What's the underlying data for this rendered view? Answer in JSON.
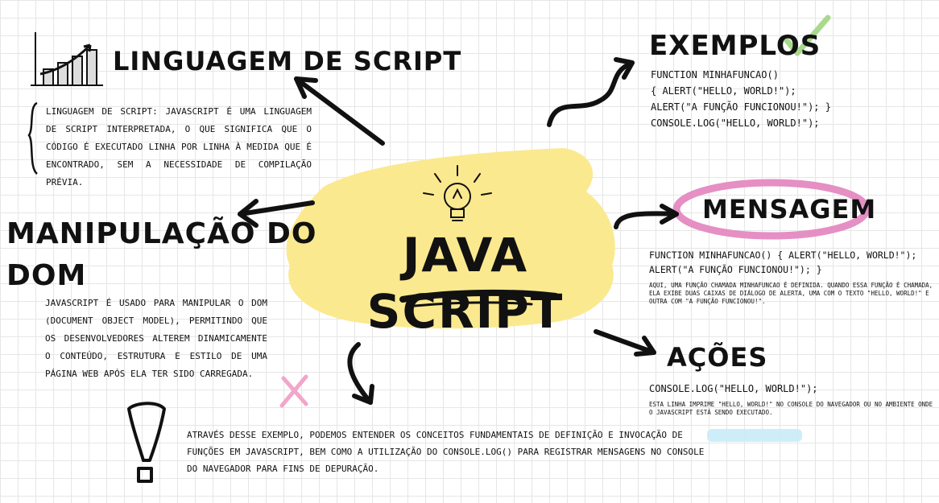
{
  "center": {
    "title": "JAVA SCRIPT"
  },
  "lingua": {
    "title": "LINGUAGEM DE SCRIPT",
    "body": "LINGUAGEM DE SCRIPT: JAVASCRIPT É UMA LINGUAGEM DE SCRIPT INTERPRETADA, O QUE SIGNIFICA QUE O CÓDIGO É EXECUTADO LINHA POR LINHA À MEDIDA QUE É ENCONTRADO, SEM A NECESSIDADE DE COMPILAÇÃO PRÉVIA."
  },
  "dom": {
    "title_line1": "MANIPULAÇÃO DO",
    "title_line2": "DOM",
    "body": "JAVASCRIPT É USADO PARA MANIPULAR O DOM (DOCUMENT OBJECT MODEL), PERMITINDO QUE OS DESENVOLVEDORES ALTEREM DINAMICAMENTE O CONTEÚDO, ESTRUTURA E ESTILO DE UMA PÁGINA WEB APÓS ELA TER SIDO CARREGADA."
  },
  "exemplos": {
    "title": "EXEMPLOS",
    "code": [
      "FUNCTION MINHAFUNCAO()",
      "{ ALERT(\"HELLO, WORLD!\");",
      "ALERT(\"A FUNÇÃO FUNCIONOU!\"); }",
      "CONSOLE.LOG(\"HELLO, WORLD!\");"
    ]
  },
  "mensagem": {
    "title": "MENSAGEM",
    "code": [
      "FUNCTION MINHAFUNCAO() { ALERT(\"HELLO, WORLD!\");",
      "ALERT(\"A FUNÇÃO FUNCIONOU!\"); }"
    ],
    "note": "AQUI, UMA FUNÇÃO CHAMADA MINHAFUNCAO É DEFINIDA. QUANDO ESSA FUNÇÃO É CHAMADA, ELA EXIBE DUAS CAIXAS DE DIÁLOGO DE ALERTA, UMA COM O TEXTO \"HELLO, WORLD!\" E OUTRA COM \"A FUNÇÃO FUNCIONOU!\"."
  },
  "acoes": {
    "title": "AÇÕES",
    "code": "CONSOLE.LOG(\"HELLO, WORLD!\");",
    "note": "ESTA LINHA IMPRIME \"HELLO, WORLD!\" NO CONSOLE DO NAVEGADOR OU NO AMBIENTE ONDE O JAVASCRIPT ESTÁ SENDO EXECUTADO."
  },
  "conclusao": {
    "body": "ATRAVÉS DESSE EXEMPLO, PODEMOS ENTENDER OS CONCEITOS FUNDAMENTAIS DE DEFINIÇÃO E INVOCAÇÃO DE FUNÇÕES EM JAVASCRIPT, BEM COMO A UTILIZAÇÃO DO CONSOLE.LOG() PARA REGISTRAR MENSAGENS NO CONSOLE DO NAVEGADOR PARA FINS DE DEPURAÇÃO."
  },
  "colors": {
    "highlight_yellow": "#fbe98f",
    "ring_pink": "#e58fc4",
    "check_green": "#a9d98c",
    "x_pink": "#f2a6c9",
    "marker_blue": "#c8ecf7"
  },
  "icons": [
    "chart-icon",
    "lightbulb-icon",
    "check-icon",
    "x-icon",
    "exclamation-icon",
    "brace-icon"
  ]
}
